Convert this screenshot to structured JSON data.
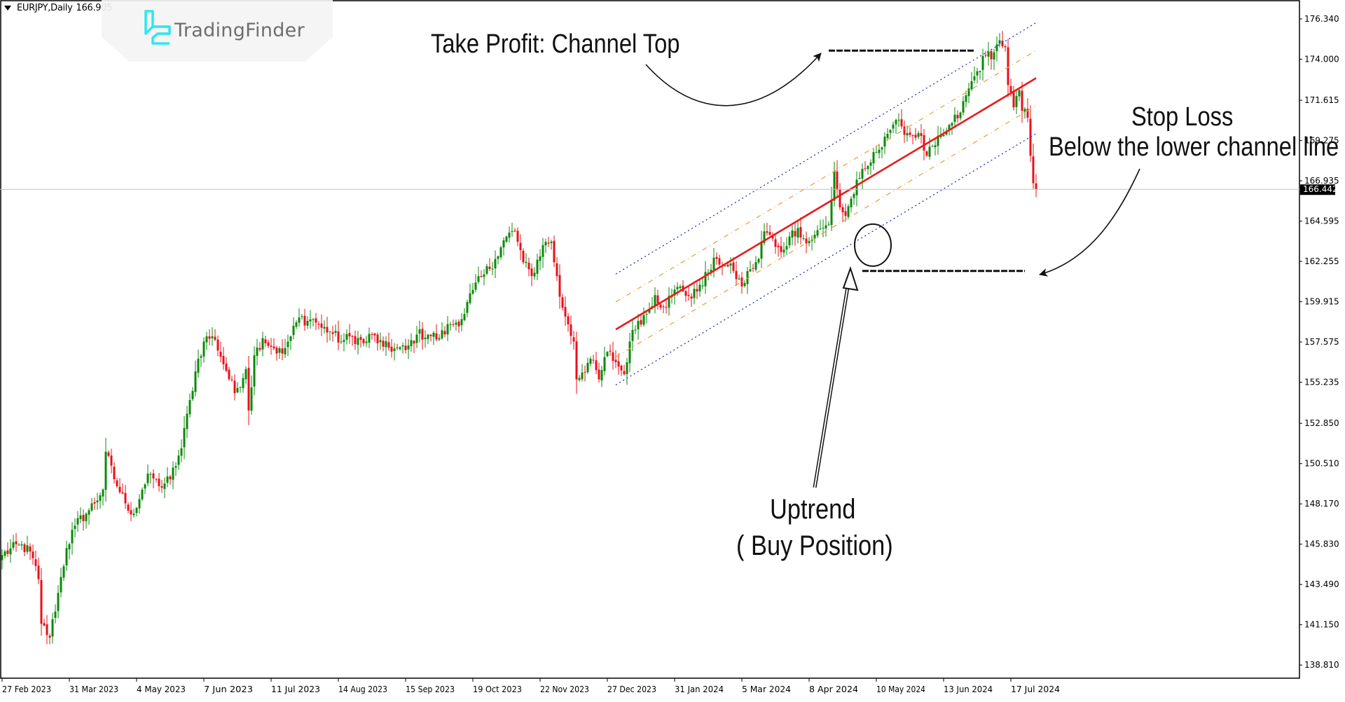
{
  "header": {
    "symbol_label": "EURJPY,Daily",
    "price_label": "166.905",
    "dropdown_icon": "triangle-down-icon"
  },
  "watermark": {
    "brand": "TradingFinder",
    "logo_icon": "tradingfinder-logo-icon",
    "logo_color": "#2ee6f0"
  },
  "annotations": {
    "take_profit": "Take Profit: Channel Top",
    "stop_loss_title": "Stop Loss",
    "stop_loss_sub": "Below the lower channel line",
    "uptrend_title": "Uptrend",
    "uptrend_sub": "( Buy Position)"
  },
  "colors": {
    "bull": "#0a8a0a",
    "bear": "#e8101a",
    "regression": "#e81a1a",
    "channel_inner": "#f0a040",
    "channel_outer": "#2030c0",
    "current_price_line": "#c0c0c0",
    "current_price_tag_bg": "#000000",
    "current_price_tag_fg": "#ffffff"
  },
  "chart_data": {
    "type": "candlestick",
    "title": "EURJPY, Daily",
    "xlabel": "",
    "ylabel": "",
    "ylim": [
      138.0,
      176.9
    ],
    "y_ticks": [
      176.34,
      174.0,
      171.615,
      169.275,
      166.935,
      164.595,
      162.255,
      159.915,
      157.575,
      155.235,
      152.85,
      150.51,
      148.17,
      145.83,
      143.49,
      141.15,
      138.81
    ],
    "y_tick_labels": [
      "176.340",
      "174.000",
      "171.615",
      "169.275",
      "166.935",
      "164.595",
      "162.255",
      "159.915",
      "157.575",
      "155.235",
      "152.850",
      "150.510",
      "148.170",
      "145.830",
      "143.490",
      "141.150",
      "138.810"
    ],
    "x_ticks": [
      {
        "bar": 0,
        "label": "27 Feb 2023"
      },
      {
        "bar": 24,
        "label": "31 Mar 2023"
      },
      {
        "bar": 48,
        "label": "4 May 2023"
      },
      {
        "bar": 72,
        "label": "7 Jun 2023"
      },
      {
        "bar": 96,
        "label": "11 Jul 2023"
      },
      {
        "bar": 120,
        "label": "14 Aug 2023"
      },
      {
        "bar": 144,
        "label": "15 Sep 2023"
      },
      {
        "bar": 168,
        "label": "19 Oct 2023"
      },
      {
        "bar": 192,
        "label": "22 Nov 2023"
      },
      {
        "bar": 216,
        "label": "27 Dec 2023"
      },
      {
        "bar": 240,
        "label": "31 Jan 2024"
      },
      {
        "bar": 264,
        "label": "5 Mar 2024"
      },
      {
        "bar": 288,
        "label": "8 Apr 2024"
      },
      {
        "bar": 312,
        "label": "10 May 2024"
      },
      {
        "bar": 336,
        "label": "13 Jun 2024"
      },
      {
        "bar": 360,
        "label": "17 Jul 2024"
      }
    ],
    "bar_count": 370,
    "grid": false,
    "current_price": 166.442,
    "close_anchors": [
      [
        0,
        145.2
      ],
      [
        6,
        145.8
      ],
      [
        10,
        145.4
      ],
      [
        13,
        143.8
      ],
      [
        14,
        141.2
      ],
      [
        17,
        140.4
      ],
      [
        20,
        143.0
      ],
      [
        23,
        145.6
      ],
      [
        26,
        146.9
      ],
      [
        31,
        147.8
      ],
      [
        36,
        149.0
      ],
      [
        37,
        151.2
      ],
      [
        40,
        149.6
      ],
      [
        44,
        148.2
      ],
      [
        47,
        147.6
      ],
      [
        50,
        149.0
      ],
      [
        53,
        149.9
      ],
      [
        56,
        149.2
      ],
      [
        60,
        149.6
      ],
      [
        64,
        151.4
      ],
      [
        67,
        154.2
      ],
      [
        70,
        156.6
      ],
      [
        73,
        157.9
      ],
      [
        76,
        157.7
      ],
      [
        80,
        155.9
      ],
      [
        83,
        154.6
      ],
      [
        87,
        156.0
      ],
      [
        88,
        153.6
      ],
      [
        90,
        156.8
      ],
      [
        93,
        157.8
      ],
      [
        97,
        157.2
      ],
      [
        100,
        156.9
      ],
      [
        103,
        157.9
      ],
      [
        106,
        159.0
      ],
      [
        109,
        158.8
      ],
      [
        111,
        158.9
      ],
      [
        114,
        158.4
      ],
      [
        117,
        158.2
      ],
      [
        121,
        157.6
      ],
      [
        125,
        157.9
      ],
      [
        129,
        157.5
      ],
      [
        132,
        158.0
      ],
      [
        136,
        157.3
      ],
      [
        140,
        157.2
      ],
      [
        144,
        157.1
      ],
      [
        148,
        158.0
      ],
      [
        152,
        158.0
      ],
      [
        156,
        157.8
      ],
      [
        160,
        158.6
      ],
      [
        164,
        158.9
      ],
      [
        168,
        160.6
      ],
      [
        172,
        161.5
      ],
      [
        176,
        162.4
      ],
      [
        180,
        163.7
      ],
      [
        183,
        164.0
      ],
      [
        186,
        162.2
      ],
      [
        189,
        161.4
      ],
      [
        193,
        163.2
      ],
      [
        196,
        163.4
      ],
      [
        199,
        160.2
      ],
      [
        202,
        158.6
      ],
      [
        204,
        157.6
      ],
      [
        205,
        155.4
      ],
      [
        207,
        155.8
      ],
      [
        210,
        156.6
      ],
      [
        213,
        155.4
      ],
      [
        216,
        157.0
      ],
      [
        219,
        156.4
      ],
      [
        222,
        155.7
      ],
      [
        224,
        157.6
      ],
      [
        227,
        158.8
      ],
      [
        230,
        159.2
      ],
      [
        233,
        160.3
      ],
      [
        236,
        159.6
      ],
      [
        239,
        160.3
      ],
      [
        242,
        160.8
      ],
      [
        246,
        160.1
      ],
      [
        249,
        160.9
      ],
      [
        252,
        161.6
      ],
      [
        255,
        162.4
      ],
      [
        258,
        162.0
      ],
      [
        261,
        161.7
      ],
      [
        264,
        160.8
      ],
      [
        267,
        161.8
      ],
      [
        270,
        162.4
      ],
      [
        272,
        164.0
      ],
      [
        274,
        163.8
      ],
      [
        276,
        163.1
      ],
      [
        278,
        162.8
      ],
      [
        281,
        163.7
      ],
      [
        284,
        164.2
      ],
      [
        287,
        163.3
      ],
      [
        290,
        163.8
      ],
      [
        293,
        164.2
      ],
      [
        295,
        164.4
      ],
      [
        297,
        167.5
      ],
      [
        299,
        165.4
      ],
      [
        301,
        164.9
      ],
      [
        303,
        165.9
      ],
      [
        306,
        167.1
      ],
      [
        309,
        167.8
      ],
      [
        312,
        168.6
      ],
      [
        315,
        169.5
      ],
      [
        318,
        170.2
      ],
      [
        321,
        170.1
      ],
      [
        324,
        169.6
      ],
      [
        327,
        169.7
      ],
      [
        330,
        168.4
      ],
      [
        333,
        169.0
      ],
      [
        336,
        169.6
      ],
      [
        339,
        170.3
      ],
      [
        342,
        170.9
      ],
      [
        345,
        172.3
      ],
      [
        348,
        173.3
      ],
      [
        351,
        174.2
      ],
      [
        354,
        174.4
      ],
      [
        356,
        175.1
      ],
      [
        358,
        174.7
      ],
      [
        359,
        172.5
      ],
      [
        361,
        171.2
      ],
      [
        363,
        172.2
      ],
      [
        364,
        171.0
      ],
      [
        366,
        170.6
      ],
      [
        367,
        168.4
      ],
      [
        368,
        166.8
      ],
      [
        369,
        166.44
      ]
    ],
    "regression_channel": {
      "start_bar": 219,
      "end_bar": 369,
      "center_start": 158.3,
      "center_end": 172.9,
      "inner_offset": 1.6,
      "outer_offset": 3.22,
      "center_style": "solid",
      "inner_style": "dash-dot",
      "outer_style": "dotted"
    },
    "levels": {
      "take_profit": {
        "price": 174.5,
        "from_bar": 295,
        "to_bar": 347,
        "style": "dashed"
      },
      "stop_loss": {
        "price": 161.7,
        "from_bar": 307,
        "to_bar": 365,
        "style": "dashed"
      }
    },
    "entry_marker": {
      "bar": 310,
      "price": 163.2,
      "shape": "ellipse"
    }
  }
}
